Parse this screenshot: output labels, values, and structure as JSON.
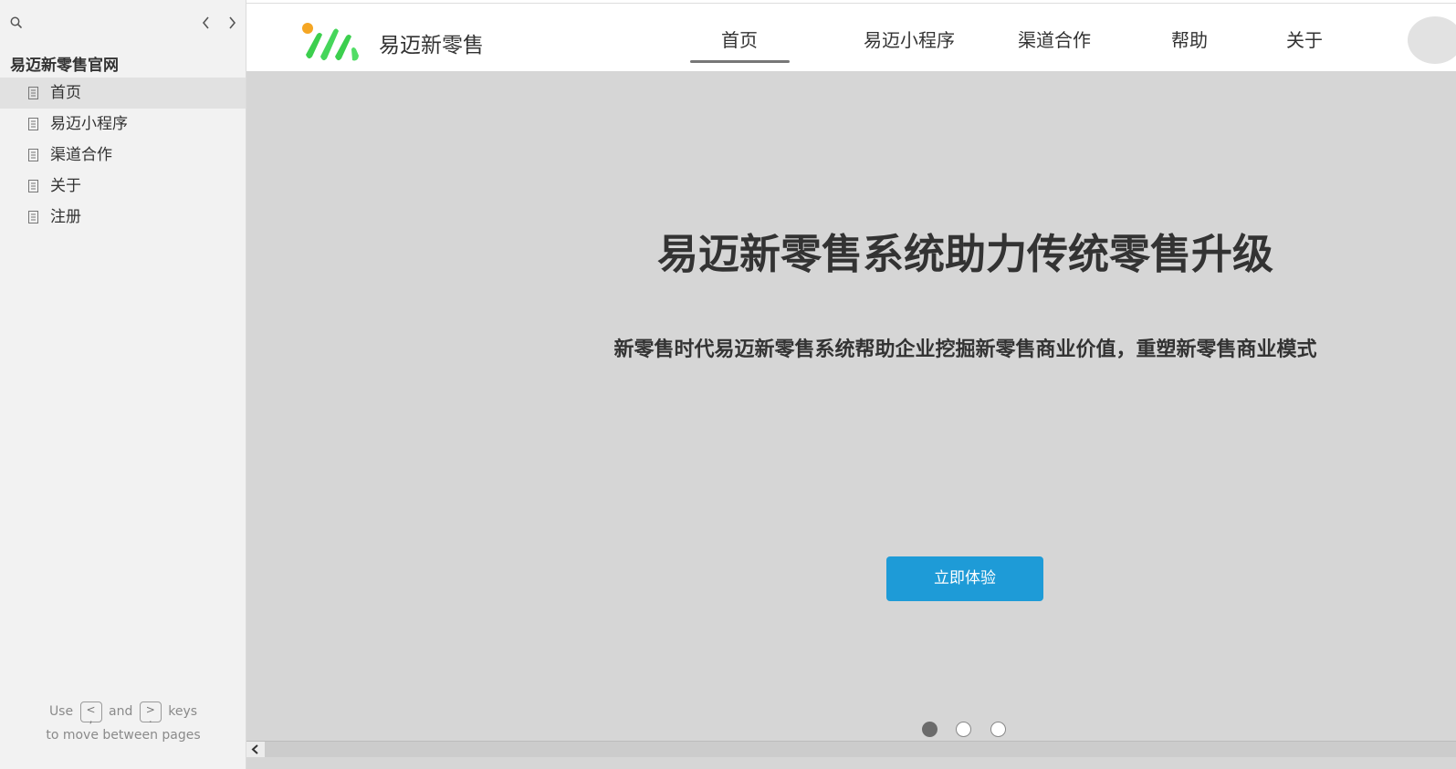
{
  "sidebar": {
    "title": "易迈新零售官网",
    "items": [
      {
        "label": "首页"
      },
      {
        "label": "易迈小程序"
      },
      {
        "label": "渠道合作"
      },
      {
        "label": "关于"
      },
      {
        "label": "注册"
      }
    ],
    "hint": {
      "use": "Use",
      "key_prev": "<",
      "key_prev_sub": ",",
      "and": "and",
      "key_next": ">",
      "key_next_sub": ".",
      "keys": "keys",
      "line2": "to move between pages"
    }
  },
  "header": {
    "brand": "易迈新零售",
    "nav": [
      {
        "label": "首页"
      },
      {
        "label": "易迈小程序"
      },
      {
        "label": "渠道合作"
      },
      {
        "label": "帮助"
      },
      {
        "label": "关于"
      }
    ]
  },
  "hero": {
    "title": "易迈新零售系统助力传统零售升级",
    "subtitle": "新零售时代易迈新零售系统帮助企业挖掘新零售商业价值，重塑新零售商业模式",
    "cta": "立即体验"
  },
  "carousel": {
    "active_index": 0,
    "count": 3
  },
  "colors": {
    "accent": "#1e9bd7",
    "hero_bg": "#d6d6d6",
    "sidebar_bg": "#f2f2f2",
    "logo_orange": "#f5a623",
    "logo_green": "#3ccf4e"
  }
}
